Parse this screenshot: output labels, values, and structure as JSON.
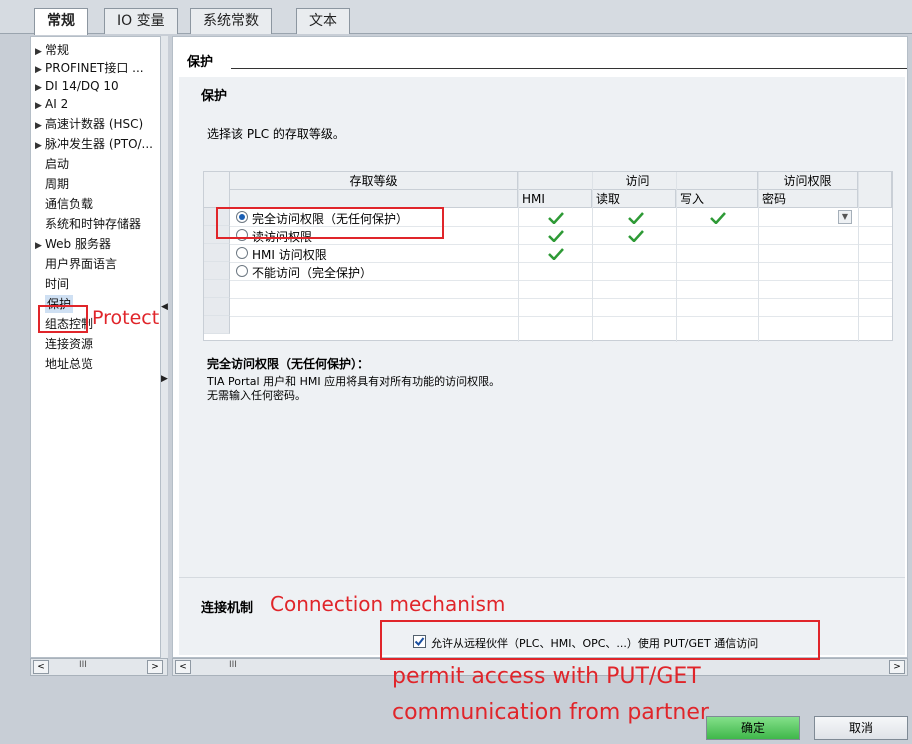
{
  "tabs": [
    {
      "label": "常规",
      "active": true
    },
    {
      "label": "IO 变量",
      "active": false
    },
    {
      "label": "系统常数",
      "active": false
    },
    {
      "label": "文本",
      "active": false
    }
  ],
  "nav": {
    "items": [
      {
        "label": "常规",
        "expandable": true
      },
      {
        "label": "PROFINET接口 ...",
        "expandable": true
      },
      {
        "label": "DI 14/DQ 10",
        "expandable": true
      },
      {
        "label": "AI 2",
        "expandable": true
      },
      {
        "label": "高速计数器 (HSC)",
        "expandable": true
      },
      {
        "label": "脉冲发生器 (PTO/...",
        "expandable": true
      },
      {
        "label": "启动",
        "expandable": false
      },
      {
        "label": "周期",
        "expandable": false
      },
      {
        "label": "通信负载",
        "expandable": false
      },
      {
        "label": "系统和时钟存储器",
        "expandable": false
      },
      {
        "label": "Web 服务器",
        "expandable": true
      },
      {
        "label": "用户界面语言",
        "expandable": false
      },
      {
        "label": "时间",
        "expandable": false
      },
      {
        "label": "保护",
        "expandable": false,
        "selected": true
      },
      {
        "label": "组态控制",
        "expandable": false
      },
      {
        "label": "连接资源",
        "expandable": false
      },
      {
        "label": "地址总览",
        "expandable": false
      }
    ],
    "scroll_thumb": "III"
  },
  "main": {
    "header_title": "保护",
    "section_title": "保护",
    "intro": "选择该 PLC 的存取等级。",
    "table": {
      "col_level": "存取等级",
      "col_access": "访问",
      "col_rights": "访问权限",
      "sub_hmi": "HMI",
      "sub_read": "读取",
      "sub_write": "写入",
      "sub_password": "密码",
      "rows": [
        {
          "label": "完全访问权限（无任何保护）",
          "selected": true,
          "hmi": true,
          "read": true,
          "write": true
        },
        {
          "label": "读访问权限",
          "selected": false,
          "hmi": true,
          "read": true,
          "write": false
        },
        {
          "label": "HMI 访问权限",
          "selected": false,
          "hmi": true,
          "read": false,
          "write": false
        },
        {
          "label": "不能访问（完全保护）",
          "selected": false,
          "hmi": false,
          "read": false,
          "write": false
        }
      ]
    },
    "desc_title": "完全访问权限（无任何保护）：",
    "desc_line1": "TIA Portal 用户和 HMI 应用将具有对所有功能的访问权限。",
    "desc_line2": "无需输入任何密码。",
    "conn_title": "连接机制",
    "conn_checkbox_label": "允许从远程伙伴（PLC、HMI、OPC、...）使用 PUT/GET 通信访问",
    "conn_checked": true
  },
  "buttons": {
    "ok": "确定",
    "cancel": "取消"
  },
  "annotations": {
    "protect": "Protect",
    "connection": "Connection mechanism",
    "permit_line1": "permit access with PUT/GET",
    "permit_line2": "communication from partner"
  },
  "colors": {
    "annotation": "#e0252a",
    "check": "#2e9a36",
    "radio_selected": "#1a5fb4"
  }
}
